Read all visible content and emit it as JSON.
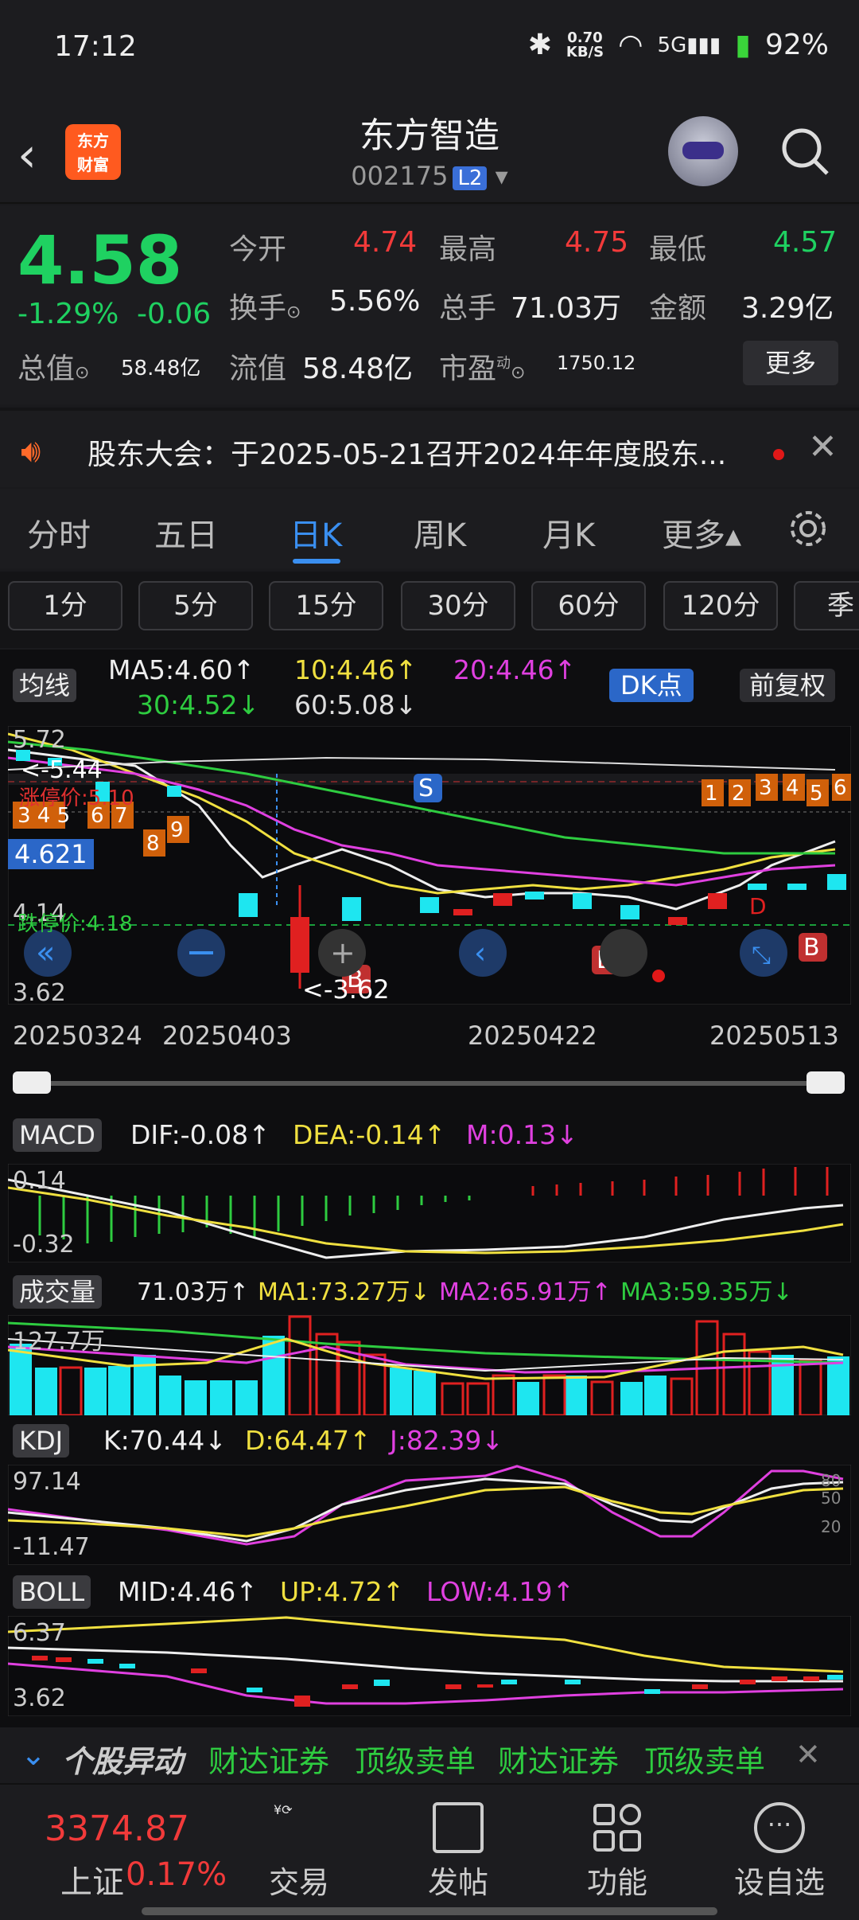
{
  "status_bar": {
    "time": "17:12",
    "speed": "0.70",
    "speed_unit": "KB/S",
    "network": "5G",
    "battery": "92%"
  },
  "header": {
    "title": "东方智造",
    "code": "002175",
    "level": "L2",
    "logo_line1": "东方",
    "logo_line2": "财富"
  },
  "quote": {
    "price": "4.58",
    "change_pct": "-1.29%",
    "change": "-0.06",
    "open_label": "今开",
    "open": "4.74",
    "high_label": "最高",
    "high": "4.75",
    "low_label": "最低",
    "low": "4.57",
    "turnover_label": "换手",
    "turnover": "5.56%",
    "volume_label": "总手",
    "volume": "71.03万",
    "amount_label": "金额",
    "amount": "3.29亿",
    "mktcap_label": "总值",
    "mktcap": "58.48亿",
    "float_label": "流值",
    "float": "58.48亿",
    "pe_label": "市盈",
    "pe_sup": "动",
    "pe": "1750.12",
    "more": "更多"
  },
  "notice": {
    "text": "股东大会：于2025-05-21召开2024年年度股东..."
  },
  "tabs": [
    "分时",
    "五日",
    "日K",
    "周K",
    "月K",
    "更多▴"
  ],
  "periods": [
    "1分",
    "5分",
    "15分",
    "30分",
    "60分",
    "120分",
    "季"
  ],
  "ma_legend": {
    "label": "均线",
    "ma5": "MA5:4.60↑",
    "ma10": "10:4.46↑",
    "ma20": "20:4.46↑",
    "ma30": "30:4.52↓",
    "ma60": "60:5.08↓",
    "dk": "DK点",
    "fq": "前复权"
  },
  "kline": {
    "high_label": "5.72",
    "hi_marker": "<-5.44",
    "limit_up": "涨停价:5.10",
    "cur": "4.621",
    "low_label": "4.14",
    "limit_down": "跌停价:4.18",
    "min_label": "3.62",
    "min_marker": "<-3.62",
    "bubble_s": "S",
    "bubble_b": "B",
    "bubble_d": "D"
  },
  "dates": [
    "20250324",
    "20250403",
    "20250422",
    "20250513"
  ],
  "macd": {
    "label": "MACD",
    "dif": "DIF:-0.08↑",
    "dea": "DEA:-0.14↑",
    "m": "M:0.13↓",
    "top": "0.14",
    "bottom": "-0.32"
  },
  "vol": {
    "label": "成交量",
    "v": "71.03万↑",
    "ma1": "MA1:73.27万↓",
    "ma2": "MA2:65.91万↑",
    "ma3": "MA3:59.35万↓",
    "top": "127.7万"
  },
  "kdj": {
    "label": "KDJ",
    "k": "K:70.44↓",
    "d": "D:64.47↑",
    "j": "J:82.39↓",
    "top": "97.14",
    "bottom": "-11.47",
    "l80": "80",
    "l50": "50",
    "l20": "20"
  },
  "boll": {
    "label": "BOLL",
    "mid": "MID:4.46↑",
    "up": "UP:4.72↑",
    "low": "LOW:4.19↑",
    "top": "6.37",
    "bottom": "3.62"
  },
  "ticker": {
    "title": "个股异动",
    "items": [
      "财达证券",
      "顶级卖单",
      "财达证券",
      "顶级卖单"
    ]
  },
  "bottom_nav": {
    "index_value": "3374.87",
    "index_name": "上证",
    "index_pct": "0.17%",
    "items": [
      "交易",
      "发帖",
      "功能",
      "设自选"
    ]
  }
}
